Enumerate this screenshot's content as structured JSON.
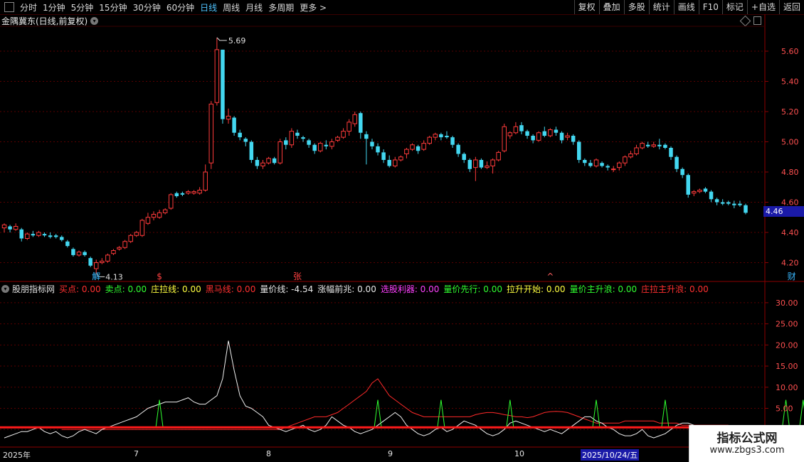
{
  "toolbar": {
    "periods": [
      "分时",
      "1分钟",
      "5分钟",
      "15分钟",
      "30分钟",
      "60分钟",
      "日线",
      "周线",
      "月线",
      "多周期",
      "更多 >"
    ],
    "active_period": "日线",
    "buttons": [
      "复权",
      "叠加",
      "多股",
      "统计",
      "画线",
      "F10",
      "标记",
      "+自选",
      "返回"
    ]
  },
  "main_chart": {
    "title": "金隅冀东(日线,前复权)",
    "price_axis": [
      "5.60",
      "5.40",
      "5.20",
      "5.00",
      "4.80",
      "4.60",
      "4.40",
      "4.20"
    ],
    "current_price": "4.46",
    "high_label": "5.69",
    "low_label": "4.13",
    "markers": [
      {
        "text": "解",
        "color": "#3ab8ff"
      },
      {
        "text": "$",
        "color": "#ff4040"
      },
      {
        "text": "张",
        "color": "#ff4040"
      },
      {
        "text": "^",
        "color": "#ff6060"
      },
      {
        "text": "财",
        "color": "#3ab8ff"
      }
    ],
    "colors": {
      "up": "#ff3b3b",
      "down": "#43d7f0",
      "grid": "#5a0000",
      "axis": "#8b0000"
    }
  },
  "indicator": {
    "name": "股朋指标网",
    "items": [
      {
        "label": "买点:",
        "value": "0.00",
        "color": "#ff3030"
      },
      {
        "label": "卖点:",
        "value": "0.00",
        "color": "#30ff30"
      },
      {
        "label": "庄拉线:",
        "value": "0.00",
        "color": "#ffff40"
      },
      {
        "label": "黑马线:",
        "value": "0.00",
        "color": "#ff3030"
      },
      {
        "label": "量价线:",
        "value": "-4.54",
        "color": "#e8e8e8"
      },
      {
        "label": "涨幅前兆:",
        "value": "0.00",
        "color": "#e8e8e8"
      },
      {
        "label": "选股利器:",
        "value": "0.00",
        "color": "#ff40ff"
      },
      {
        "label": "量价先行:",
        "value": "0.00",
        "color": "#30ff30"
      },
      {
        "label": "拉升开始:",
        "value": "0.00",
        "color": "#ffff40"
      },
      {
        "label": "量价主升浪:",
        "value": "0.00",
        "color": "#30ff30"
      },
      {
        "label": "庄拉主升浪:",
        "value": "0.00",
        "color": "#ff3030"
      }
    ],
    "axis": [
      "30.00",
      "25.00",
      "20.00",
      "15.00",
      "10.00",
      "5.00",
      "0.00"
    ]
  },
  "dates": [
    "2025年",
    "7",
    "8",
    "9",
    "10",
    "2025/10/24/五"
  ],
  "watermark": {
    "line1": "指标公式网",
    "line2": "www.zbgs3.com"
  },
  "chart_data": {
    "type": "candlestick",
    "price_ylim": [
      4.08,
      5.76
    ],
    "candles": [
      [
        4.43,
        4.45,
        4.4,
        4.46
      ],
      [
        4.44,
        4.42,
        4.4,
        4.45
      ],
      [
        4.42,
        4.44,
        4.41,
        4.46
      ],
      [
        4.42,
        4.36,
        4.34,
        4.43
      ],
      [
        4.36,
        4.39,
        4.35,
        4.4
      ],
      [
        4.39,
        4.38,
        4.37,
        4.41
      ],
      [
        4.38,
        4.4,
        4.37,
        4.41
      ],
      [
        4.39,
        4.38,
        4.37,
        4.4
      ],
      [
        4.38,
        4.37,
        4.36,
        4.4
      ],
      [
        4.38,
        4.37,
        4.36,
        4.39
      ],
      [
        4.37,
        4.35,
        4.34,
        4.38
      ],
      [
        4.34,
        4.31,
        4.3,
        4.35
      ],
      [
        4.29,
        4.25,
        4.24,
        4.3
      ],
      [
        4.25,
        4.27,
        4.24,
        4.28
      ],
      [
        4.27,
        4.25,
        4.24,
        4.28
      ],
      [
        4.23,
        4.18,
        4.17,
        4.24
      ],
      [
        4.16,
        4.2,
        4.13,
        4.22
      ],
      [
        4.2,
        4.21,
        4.19,
        4.23
      ],
      [
        4.21,
        4.25,
        4.2,
        4.26
      ],
      [
        4.26,
        4.28,
        4.25,
        4.29
      ],
      [
        4.29,
        4.3,
        4.28,
        4.31
      ],
      [
        4.3,
        4.34,
        4.29,
        4.35
      ],
      [
        4.34,
        4.38,
        4.33,
        4.39
      ],
      [
        4.38,
        4.4,
        4.37,
        4.41
      ],
      [
        4.38,
        4.48,
        4.37,
        4.49
      ],
      [
        4.46,
        4.5,
        4.45,
        4.53
      ],
      [
        4.5,
        4.52,
        4.48,
        4.54
      ],
      [
        4.5,
        4.53,
        4.49,
        4.55
      ],
      [
        4.53,
        4.55,
        4.52,
        4.56
      ],
      [
        4.56,
        4.65,
        4.55,
        4.66
      ],
      [
        4.66,
        4.64,
        4.63,
        4.67
      ],
      [
        4.66,
        4.65,
        4.64,
        4.67
      ],
      [
        4.66,
        4.67,
        4.65,
        4.68
      ],
      [
        4.66,
        4.67,
        4.65,
        4.68
      ],
      [
        4.66,
        4.68,
        4.65,
        4.7
      ],
      [
        4.68,
        4.8,
        4.67,
        4.85
      ],
      [
        4.86,
        5.25,
        4.82,
        5.27
      ],
      [
        5.26,
        5.61,
        5.24,
        5.69
      ],
      [
        5.61,
        5.15,
        5.12,
        5.61
      ],
      [
        5.15,
        5.17,
        5.12,
        5.22
      ],
      [
        5.16,
        5.06,
        5.04,
        5.17
      ],
      [
        5.06,
        5.03,
        5.01,
        5.08
      ],
      [
        5.02,
        5.0,
        4.97,
        5.03
      ],
      [
        5.0,
        4.88,
        4.86,
        5.01
      ],
      [
        4.88,
        4.84,
        4.82,
        4.9
      ],
      [
        4.84,
        4.86,
        4.82,
        4.88
      ],
      [
        4.86,
        4.89,
        4.85,
        4.9
      ],
      [
        4.89,
        4.86,
        4.85,
        4.9
      ],
      [
        4.86,
        5.0,
        4.85,
        5.02
      ],
      [
        5.01,
        4.98,
        4.95,
        5.03
      ],
      [
        4.98,
        5.07,
        4.96,
        5.09
      ],
      [
        5.06,
        5.04,
        5.02,
        5.08
      ],
      [
        5.03,
        5.02,
        5.0,
        5.04
      ],
      [
        5.01,
        4.98,
        4.96,
        5.02
      ],
      [
        4.98,
        4.94,
        4.92,
        4.99
      ],
      [
        4.94,
        4.99,
        4.93,
        5.0
      ],
      [
        4.98,
        4.97,
        4.95,
        5.01
      ],
      [
        4.97,
        5.0,
        4.95,
        5.02
      ],
      [
        5.01,
        5.03,
        5.0,
        5.04
      ],
      [
        5.03,
        5.07,
        5.02,
        5.09
      ],
      [
        5.07,
        5.13,
        5.04,
        5.15
      ],
      [
        5.12,
        5.18,
        5.1,
        5.2
      ],
      [
        5.19,
        5.06,
        5.02,
        5.2
      ],
      [
        5.05,
        5.02,
        4.85,
        5.07
      ],
      [
        5.0,
        4.97,
        4.95,
        5.02
      ],
      [
        4.97,
        4.93,
        4.91,
        4.99
      ],
      [
        4.93,
        4.88,
        4.86,
        4.95
      ],
      [
        4.88,
        4.84,
        4.83,
        4.91
      ],
      [
        4.84,
        4.88,
        4.83,
        4.9
      ],
      [
        4.88,
        4.9,
        4.87,
        4.91
      ],
      [
        4.92,
        4.95,
        4.89,
        4.96
      ],
      [
        4.95,
        4.98,
        4.94,
        4.99
      ],
      [
        4.97,
        4.94,
        4.92,
        4.98
      ],
      [
        4.95,
        4.99,
        4.94,
        5.01
      ],
      [
        4.99,
        5.03,
        4.98,
        5.04
      ],
      [
        5.03,
        5.05,
        5.01,
        5.06
      ],
      [
        5.05,
        5.03,
        5.01,
        5.06
      ],
      [
        5.04,
        5.03,
        5.02,
        5.07
      ],
      [
        5.03,
        4.98,
        4.96,
        5.04
      ],
      [
        4.98,
        4.92,
        4.9,
        4.99
      ],
      [
        4.92,
        4.88,
        4.86,
        4.93
      ],
      [
        4.88,
        4.82,
        4.8,
        4.89
      ],
      [
        4.83,
        4.88,
        4.74,
        4.9
      ],
      [
        4.88,
        4.83,
        4.82,
        4.89
      ],
      [
        4.83,
        4.84,
        4.82,
        4.87
      ],
      [
        4.84,
        4.88,
        4.79,
        4.89
      ],
      [
        4.88,
        4.93,
        4.87,
        4.94
      ],
      [
        4.94,
        5.1,
        4.93,
        5.12
      ],
      [
        5.04,
        5.06,
        5.02,
        5.07
      ],
      [
        5.06,
        5.1,
        5.05,
        5.13
      ],
      [
        5.11,
        5.07,
        5.05,
        5.13
      ],
      [
        5.07,
        5.04,
        5.02,
        5.08
      ],
      [
        5.04,
        5.01,
        4.99,
        5.05
      ],
      [
        5.01,
        5.06,
        5.0,
        5.07
      ],
      [
        5.07,
        5.04,
        5.03,
        5.1
      ],
      [
        5.04,
        5.08,
        5.03,
        5.09
      ],
      [
        5.08,
        5.06,
        5.04,
        5.1
      ],
      [
        5.06,
        5.01,
        4.99,
        5.07
      ],
      [
        5.03,
        5.04,
        5.01,
        5.06
      ],
      [
        5.04,
        5.0,
        4.98,
        5.05
      ],
      [
        5.0,
        4.88,
        4.86,
        5.01
      ],
      [
        4.88,
        4.86,
        4.84,
        4.89
      ],
      [
        4.86,
        4.84,
        4.83,
        4.88
      ],
      [
        4.84,
        4.88,
        4.83,
        4.89
      ],
      [
        4.86,
        4.84,
        4.83,
        4.87
      ],
      [
        4.84,
        4.83,
        4.81,
        4.85
      ],
      [
        4.82,
        4.82,
        4.8,
        4.84
      ],
      [
        4.83,
        4.86,
        4.81,
        4.87
      ],
      [
        4.86,
        4.9,
        4.84,
        4.91
      ],
      [
        4.9,
        4.92,
        4.89,
        4.94
      ],
      [
        4.92,
        4.96,
        4.91,
        4.98
      ],
      [
        4.96,
        4.99,
        4.95,
        5.0
      ],
      [
        4.98,
        4.97,
        4.96,
        5.0
      ],
      [
        4.97,
        4.98,
        4.96,
        5.0
      ],
      [
        4.98,
        4.97,
        4.95,
        5.02
      ],
      [
        4.98,
        4.96,
        4.95,
        4.99
      ],
      [
        4.96,
        4.9,
        4.88,
        4.97
      ],
      [
        4.9,
        4.82,
        4.8,
        4.91
      ],
      [
        4.82,
        4.78,
        4.76,
        4.83
      ],
      [
        4.78,
        4.65,
        4.63,
        4.79
      ],
      [
        4.66,
        4.67,
        4.64,
        4.68
      ],
      [
        4.67,
        4.68,
        4.66,
        4.69
      ],
      [
        4.69,
        4.67,
        4.66,
        4.7
      ],
      [
        4.67,
        4.62,
        4.6,
        4.68
      ],
      [
        4.62,
        4.6,
        4.58,
        4.63
      ],
      [
        4.6,
        4.59,
        4.58,
        4.62
      ],
      [
        4.6,
        4.59,
        4.58,
        4.61
      ],
      [
        4.59,
        4.58,
        4.56,
        4.61
      ],
      [
        4.59,
        4.58,
        4.57,
        4.61
      ],
      [
        4.58,
        4.53,
        4.52,
        4.59
      ]
    ],
    "indicator_ylim": [
      -4,
      32
    ],
    "red_level": 0.5,
    "white_line": [
      -2,
      -1.5,
      -1,
      -0.5,
      -0.5,
      0,
      0.5,
      -0.5,
      -1,
      -0.5,
      -1.5,
      -2,
      -1.5,
      -0.5,
      0,
      -0.5,
      -1,
      0,
      0.5,
      1,
      1.5,
      2,
      2.5,
      3,
      4,
      5,
      5.5,
      6,
      6.5,
      6.5,
      6.5,
      7,
      7.5,
      6.5,
      6,
      6,
      7,
      8,
      12,
      21,
      14,
      8,
      5.5,
      5,
      4,
      3,
      1,
      0.5,
      0,
      -0.5,
      0,
      0.5,
      1,
      0,
      -0.5,
      0,
      1,
      3,
      2,
      1,
      0.5,
      -0.5,
      -1,
      -0.5,
      0,
      1,
      2,
      3,
      4,
      3,
      1,
      0,
      -1,
      -1.5,
      -1,
      0,
      0.5,
      -0.5,
      0,
      1,
      2,
      1.5,
      1,
      0,
      -1,
      -1.5,
      -1,
      0,
      1.5,
      2,
      1.5,
      1,
      0.5,
      0,
      -0.5,
      0,
      -0.5,
      -1,
      0,
      1,
      2,
      3,
      3,
      2,
      1.5,
      0.5,
      0,
      -1,
      -1.5,
      -1.5,
      -1,
      0,
      -1.5,
      -2,
      -1.5,
      -1,
      0,
      1,
      1.5,
      1.5,
      1,
      0.5,
      0,
      -1,
      -2,
      -2.5,
      -3,
      -3.5,
      -3.5,
      -4,
      -4.5,
      -4.5,
      -4.54
    ],
    "red_line": [
      0,
      0,
      0,
      0,
      0,
      0,
      0,
      0,
      0,
      0,
      0,
      0,
      0,
      0,
      0,
      0,
      0,
      0,
      0,
      0,
      0,
      0,
      0,
      0,
      0,
      0,
      0,
      0,
      0,
      0,
      0,
      0,
      0,
      0,
      0,
      0,
      0,
      0,
      0,
      0.5,
      1,
      1.5,
      2,
      2.5,
      3,
      3,
      3,
      3.5,
      4,
      5,
      6,
      7,
      8,
      9,
      11,
      12,
      10,
      8,
      7,
      6,
      5,
      4,
      3.5,
      3,
      3,
      3,
      3,
      3,
      3,
      3,
      3,
      3,
      3.5,
      3.8,
      4,
      4,
      3.8,
      3.5,
      3.3,
      3,
      3,
      2.8,
      3,
      3.5,
      4,
      4.2,
      4.3,
      4.2,
      4,
      3.5,
      3,
      2.5,
      2,
      1.5,
      1.5,
      1.5,
      1.5,
      1.5,
      2,
      2,
      2,
      2,
      2,
      2,
      1.5,
      1.5,
      1.5,
      1.5,
      1,
      1,
      1,
      1,
      1,
      1,
      1,
      1,
      1
    ],
    "green_spikes": [
      27,
      65,
      76,
      88,
      103,
      115,
      136,
      139
    ]
  }
}
